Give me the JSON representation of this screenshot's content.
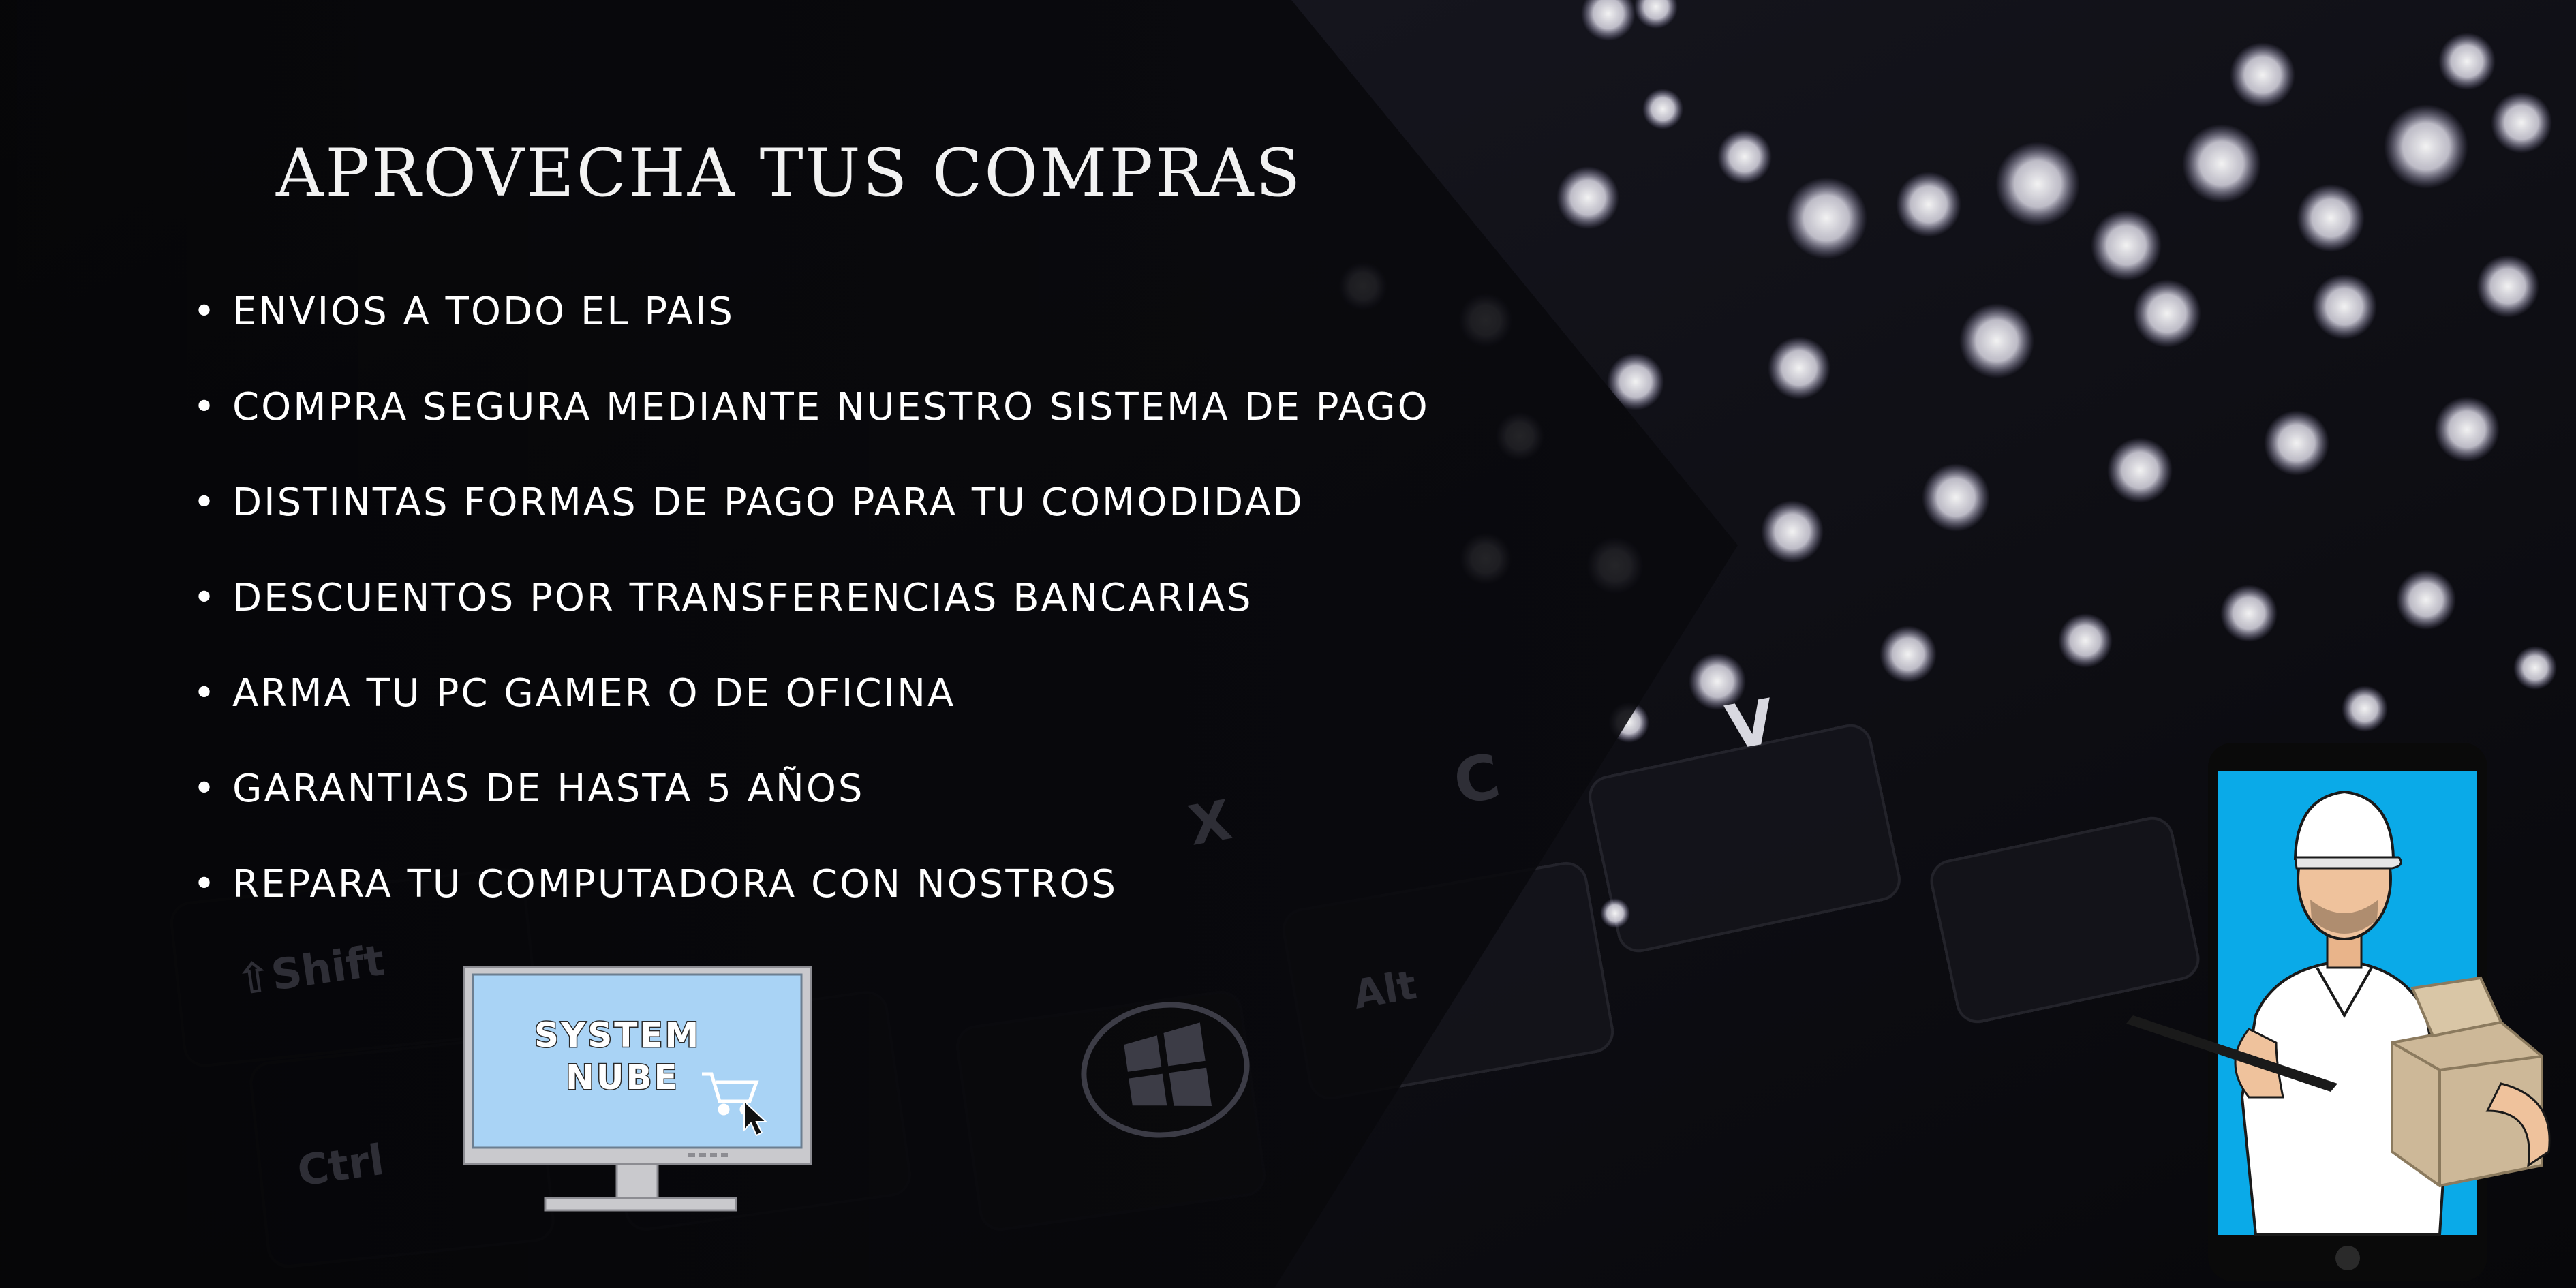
{
  "headline": "APROVECHA TUS COMPRAS",
  "bullet_glyph": "•",
  "features": [
    "ENVIOS A TODO EL PAIS",
    "COMPRA SEGURA MEDIANTE NUESTRO SISTEMA DE PAGO",
    "DISTINTAS FORMAS DE PAGO PARA TU COMODIDAD",
    "DESCUENTOS POR TRANSFERENCIAS BANCARIAS",
    "ARMA TU PC GAMER O DE OFICINA",
    "GARANTIAS DE HASTA 5 AÑOS",
    "REPARA TU COMPUTADORA CON NOSTROS"
  ],
  "logo": {
    "line1": "SYSTEM",
    "line2": "NUBE"
  },
  "keyboard_keys": {
    "shift": "⇧Shift",
    "ctrl": "Ctrl",
    "alt": "Alt",
    "x": "X",
    "c": "C",
    "v": "V"
  },
  "colors": {
    "background": "#0c0c10",
    "text": "#ffffff",
    "logo_screen": "#a9d3f5",
    "phone_screen": "#0aaae8",
    "box": "#cdb898"
  }
}
